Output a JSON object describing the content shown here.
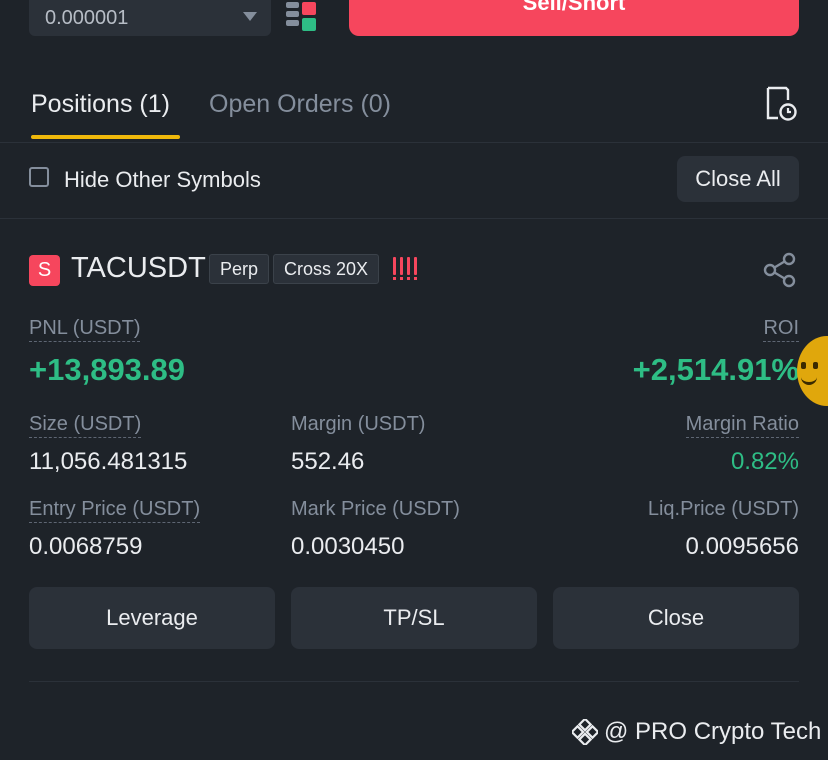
{
  "order_form": {
    "tick_size": "0.000001",
    "sell_button_label": "Sell/Short",
    "colors": {
      "sell": "#f6465d",
      "buy": "#2ebd85"
    }
  },
  "tabs": [
    {
      "label": "Positions (1)",
      "active": true
    },
    {
      "label": "Open Orders (0)",
      "active": false
    }
  ],
  "filter": {
    "hide_other_symbols_label": "Hide Other Symbols",
    "hide_other_symbols_checked": false,
    "close_all_label": "Close All"
  },
  "position": {
    "side_badge": "S",
    "symbol": "TACUSDT",
    "contract_tag": "Perp",
    "margin_mode_tag": "Cross 20X",
    "pnl_label": "PNL (USDT)",
    "pnl_value": "+13,893.89",
    "roi_label": "ROI",
    "roi_value": "+2,514.91%",
    "size_label": "Size (USDT)",
    "size_value": "11,056.481315",
    "margin_label": "Margin (USDT)",
    "margin_value": "552.46",
    "margin_ratio_label": "Margin Ratio",
    "margin_ratio_value": "0.82%",
    "entry_price_label": "Entry Price (USDT)",
    "entry_price_value": "0.0068759",
    "mark_price_label": "Mark Price (USDT)",
    "mark_price_value": "0.0030450",
    "liq_price_label": "Liq.Price (USDT)",
    "liq_price_value": "0.0095656",
    "actions": {
      "leverage": "Leverage",
      "tpsl": "TP/SL",
      "close": "Close"
    }
  },
  "watermark": "@ PRO Crypto Tech"
}
